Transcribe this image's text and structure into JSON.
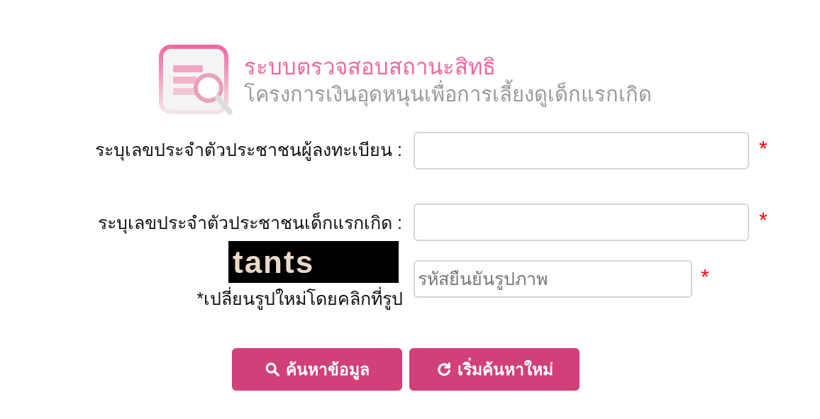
{
  "header": {
    "title": "ระบบตรวจสอบสถานะสิทธิ",
    "subtitle": "โครงการเงินอุดหนุนเพื่อการเลี้ยงดูเด็กแรกเกิด"
  },
  "fields": [
    {
      "label": "ระบุเลขประจำตัวประชาชนผู้ลงทะเบียน :",
      "required_mark": "*"
    },
    {
      "label": "ระบุเลขประจำตัวประชาชนเด็กแรกเกิด :",
      "required_mark": "*"
    }
  ],
  "captcha": {
    "text": "tants",
    "hint": "*เปลี่ยนรูปใหม่โดยคลิกที่รูป",
    "placeholder": "รหัสยืนยันรูปภาพ",
    "required_mark": "*"
  },
  "buttons": [
    {
      "label": "ค้นหาข้อมูล",
      "kind": "search"
    },
    {
      "label": "เริ่มค้นหาใหม่",
      "kind": "reset"
    }
  ]
}
